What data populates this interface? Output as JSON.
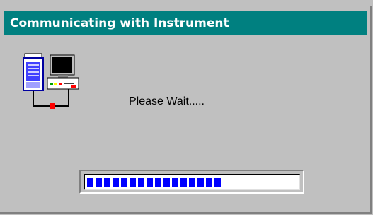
{
  "dialog": {
    "title": "Communicating with Instrument",
    "message": "Please Wait.....",
    "icon": "instrument-computer-connection-icon"
  },
  "progress": {
    "fraction": 0.6,
    "filled_blocks": 16,
    "color": "#0000ff"
  },
  "colors": {
    "title_bar": "#008080",
    "title_text": "#ffffff",
    "window_bg": "#c0c0c0"
  }
}
